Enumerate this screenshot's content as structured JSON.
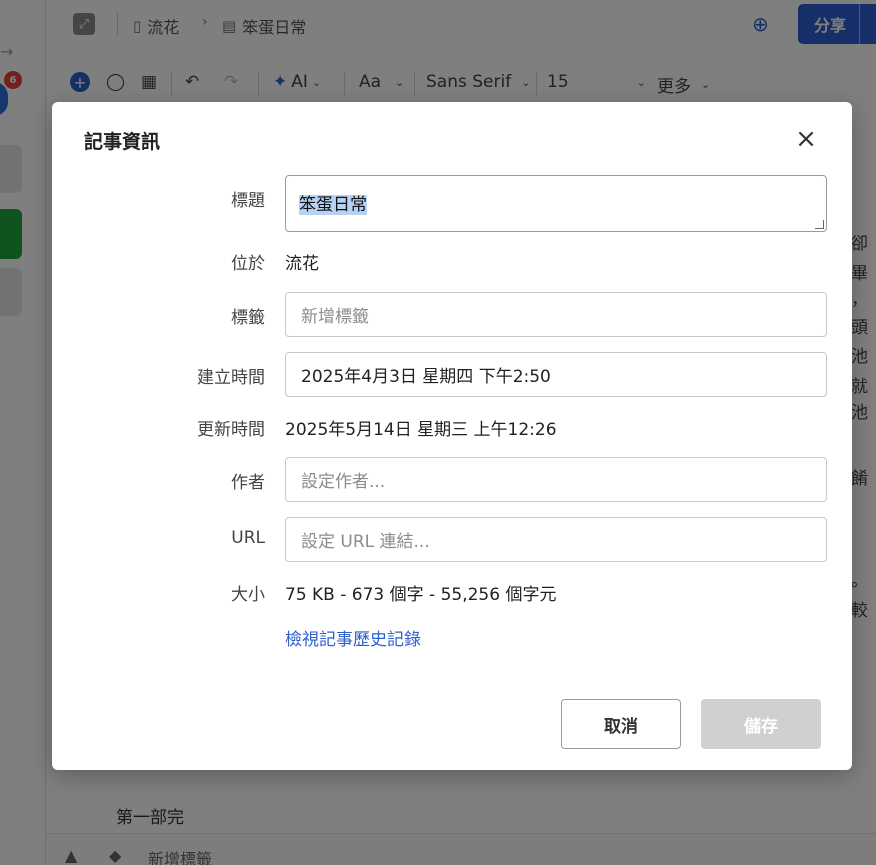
{
  "rail": {
    "badge_count": "6"
  },
  "breadcrumb": {
    "notebook": "流花",
    "note": "笨蛋日常"
  },
  "header": {
    "share_label": "分享"
  },
  "toolbar": {
    "ai_label": "AI",
    "font_size_label": "Aa",
    "font_family": "Sans Serif",
    "font_size": "15",
    "more_label": "更多"
  },
  "editor": {
    "right_edge_chars": [
      "卻",
      "畢",
      "，",
      "頭",
      "池",
      "就",
      "池",
      "餚",
      "。",
      "較"
    ],
    "part_end": "第一部完"
  },
  "bottom_bar": {
    "add_tag": "新增標籤"
  },
  "dialog": {
    "title": "記事資訊",
    "fields": {
      "title_label": "標題",
      "title_value": "笨蛋日常",
      "location_label": "位於",
      "location_value": "流花",
      "tags_label": "標籤",
      "tags_placeholder": "新增標籤",
      "created_label": "建立時間",
      "created_value": "2025年4月3日 星期四 下午2:50",
      "updated_label": "更新時間",
      "updated_value": "2025年5月14日 星期三 上午12:26",
      "author_label": "作者",
      "author_placeholder": "設定作者...",
      "url_label": "URL",
      "url_placeholder": "設定 URL 連結...",
      "size_label": "大小",
      "size_value": "75 KB - 673 個字 - 55,256 個字元"
    },
    "history_link": "檢視記事歷史記錄",
    "cancel_label": "取消",
    "save_label": "儲存"
  },
  "colors": {
    "accent": "#2d5fd0",
    "badge": "#e2453b",
    "selection": "#b6d1f3",
    "save_disabled": "#d0d0d0"
  }
}
